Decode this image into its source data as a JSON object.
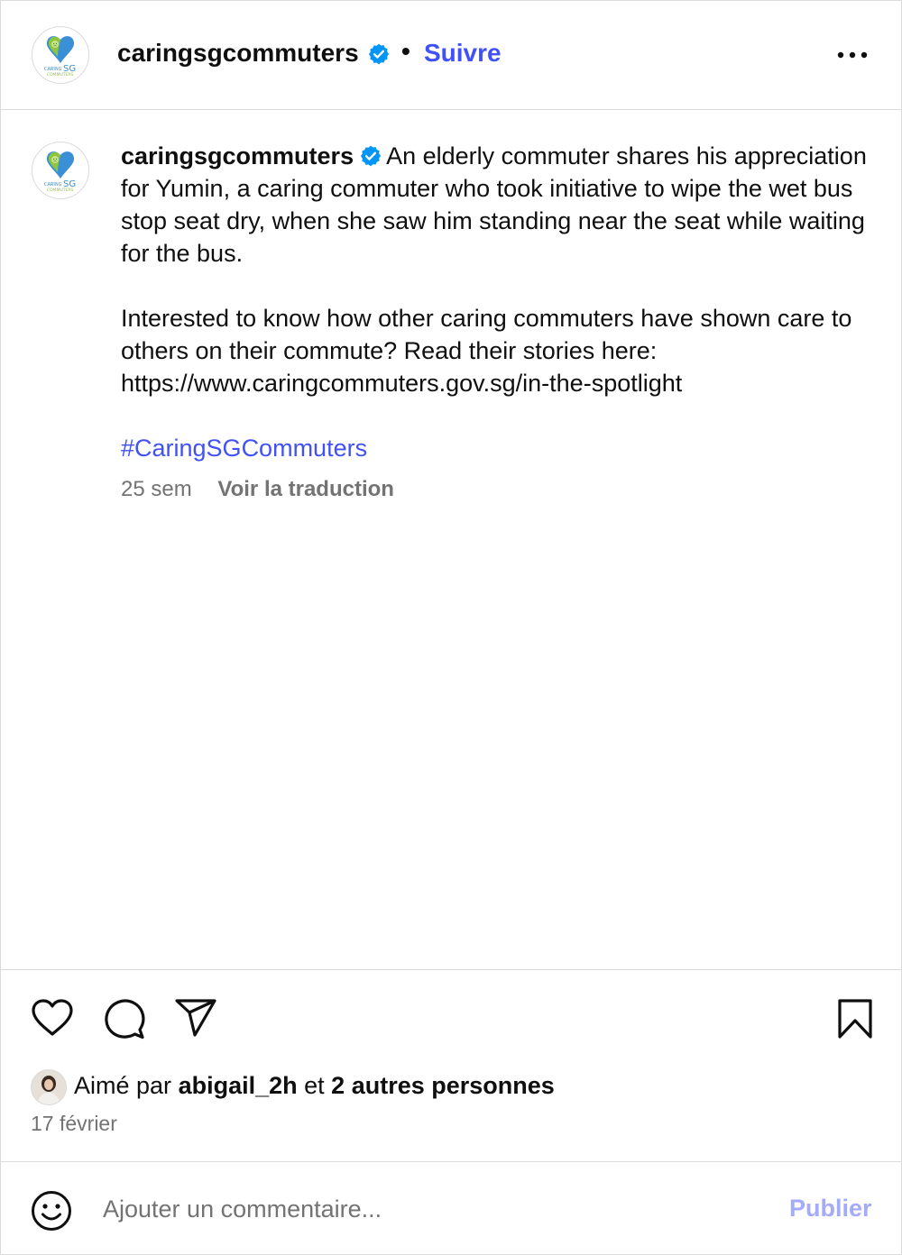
{
  "header": {
    "username": "caringsgcommuters",
    "separator": "•",
    "follow_label": "Suivre",
    "logo_text": "CARING SG COMMUTERS",
    "more_icon": "more-horizontal-icon"
  },
  "caption": {
    "username": "caringsgcommuters",
    "paragraph_1": "An elderly commuter shares his appreciation for Yumin, a caring commuter who took initiative to wipe the wet bus stop seat dry, when she saw him standing near the seat while waiting for the bus.",
    "paragraph_2": "Interested to know how other caring commuters have shown care to others on their commute? Read their stories here: https://www.caringcommuters.gov.sg/in-the-spotlight",
    "hashtag": "#CaringSGCommuters",
    "time": "25 sem",
    "translate_label": "Voir la traduction"
  },
  "actions": {
    "icons": [
      "heart-icon",
      "comment-icon",
      "share-icon",
      "bookmark-icon"
    ],
    "liked_prefix": "Aimé par",
    "liked_user": "abigail_2h",
    "liked_and": "et",
    "liked_others": "2 autres personnes",
    "date": "17 février"
  },
  "comment_bar": {
    "placeholder": "Ajouter un commentaire...",
    "value": "",
    "publish_label": "Publier",
    "emoji_icon": "emoji-icon"
  },
  "colors": {
    "link_blue": "#4150f7",
    "publish_disabled": "#a4acfa",
    "verified_blue": "#0095f6",
    "secondary_text": "#737373",
    "border": "#dbdbdb"
  }
}
